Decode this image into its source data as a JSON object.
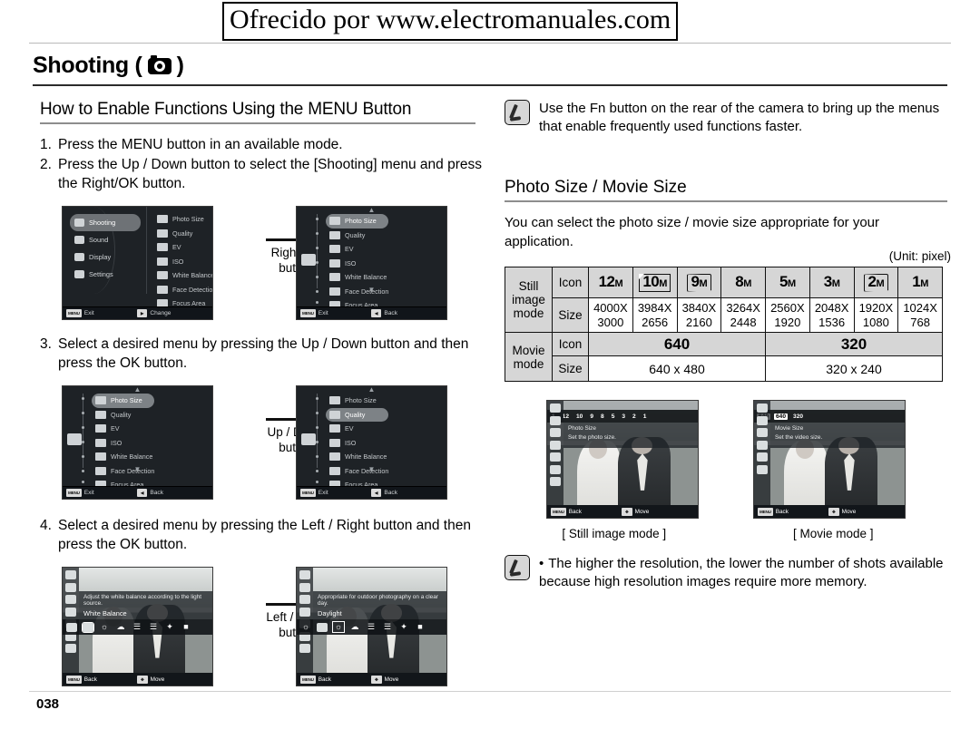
{
  "watermark": "Ofrecido por www.electromanuales.com",
  "chapter": {
    "title": "Shooting (",
    "title_close": ")",
    "icon": "camera-icon"
  },
  "left": {
    "heading": "How to Enable Functions Using the MENU Button",
    "steps": [
      {
        "num": "1.",
        "text": "Press the MENU button in an available mode."
      },
      {
        "num": "2.",
        "text": "Press the Up / Down button to select the [Shooting] menu and press the Right/OK button."
      },
      {
        "num": "3.",
        "text": "Select a desired menu by pressing the Up / Down button and then press the OK button."
      },
      {
        "num": "4.",
        "text": "Select a desired menu by pressing the Left / Right button and then press the OK button."
      }
    ],
    "arrows": [
      {
        "line1": "Right/OK",
        "line2": "button"
      },
      {
        "line1": "Up / Down",
        "line2": "button"
      },
      {
        "line1": "Left / Right",
        "line2": "button"
      }
    ]
  },
  "menu_screen_1": {
    "modes": [
      {
        "label": "Shooting",
        "icon": "camera-icon",
        "selected": true
      },
      {
        "label": "Sound",
        "icon": "speaker-icon",
        "selected": false
      },
      {
        "label": "Display",
        "icon": "display-icon",
        "selected": false
      },
      {
        "label": "Settings",
        "icon": "gear-icon",
        "selected": false
      }
    ],
    "options": [
      {
        "label": "Photo Size",
        "icon": "photo-size-icon"
      },
      {
        "label": "Quality",
        "icon": "quality-icon"
      },
      {
        "label": "EV",
        "icon": "ev-icon"
      },
      {
        "label": "ISO",
        "icon": "iso-icon"
      },
      {
        "label": "White Balance",
        "icon": "white-balance-icon"
      },
      {
        "label": "Face Detection",
        "icon": "face-detection-icon"
      },
      {
        "label": "Focus Area",
        "icon": "focus-area-icon"
      }
    ],
    "footer_left_key": "MENU",
    "footer_left_label": "Exit",
    "footer_right_key": "▶",
    "footer_right_label": "Change"
  },
  "menu_screen_2": {
    "selected": "Photo Size",
    "footer_left_key": "MENU",
    "footer_left_label": "Exit",
    "footer_right_key": "◀",
    "footer_right_label": "Back"
  },
  "menu_screen_3": {
    "selected": "Photo Size",
    "footer_left_key": "MENU",
    "footer_left_label": "Exit",
    "footer_right_key": "◀",
    "footer_right_label": "Back"
  },
  "menu_screen_4": {
    "selected": "Quality",
    "footer_left_key": "MENU",
    "footer_left_label": "Exit",
    "footer_right_key": "◀",
    "footer_right_label": "Back"
  },
  "wb_screen_1": {
    "desc": "Adjust the white balance according to the light source.",
    "name": "White Balance",
    "footer_left_key": "MENU",
    "footer_left_label": "Back",
    "footer_right_key": "✥",
    "footer_right_label": "Move"
  },
  "wb_screen_2": {
    "desc": "Appropriate for outdoor photography on a clear day.",
    "name": "Daylight",
    "footer_left_key": "MENU",
    "footer_left_label": "Back",
    "footer_right_key": "✥",
    "footer_right_label": "Move"
  },
  "right": {
    "note1": "Use the Fn button on the rear of the camera to bring up the menus that enable frequently used functions faster.",
    "heading": "Photo Size / Movie Size",
    "paragraph": "You can select the photo size / movie size appropriate for your application.",
    "unit": "(Unit: pixel)",
    "note2": "The higher the resolution, the lower the number of shots available because high resolution images require more memory.",
    "caption_still": "[ Still image mode ]",
    "caption_movie": "[ Movie mode ]"
  },
  "still_screen": {
    "sizes": [
      "1",
      "12",
      "10",
      "9",
      "8",
      "5",
      "3",
      "2",
      "1"
    ],
    "title": "Photo Size",
    "desc": "Set the photo size.",
    "footer_left_key": "MENU",
    "footer_left_label": "Back",
    "footer_right_key": "✥",
    "footer_right_label": "Move"
  },
  "movie_screen": {
    "sizes": [
      "640",
      "640",
      "320"
    ],
    "title": "Movie Size",
    "desc": "Set the video size.",
    "footer_left_key": "MENU",
    "footer_left_label": "Back",
    "footer_right_key": "✥",
    "footer_right_label": "Move"
  },
  "chart_data": {
    "type": "table",
    "title": "Photo Size / Movie Size",
    "unit": "(Unit: pixel)",
    "still": {
      "row_label": "Still image mode",
      "icon_label": "Icon",
      "size_label": "Size",
      "icons": [
        {
          "num": "12",
          "m": "M",
          "style": "plain"
        },
        {
          "num": "10",
          "m": "M",
          "style": "corner"
        },
        {
          "num": "9",
          "m": "M",
          "style": "wavy"
        },
        {
          "num": "8",
          "m": "M",
          "style": "plain"
        },
        {
          "num": "5",
          "m": "M",
          "style": "plain"
        },
        {
          "num": "3",
          "m": "M",
          "style": "plain"
        },
        {
          "num": "2",
          "m": "M",
          "style": "wavy"
        },
        {
          "num": "1",
          "m": "M",
          "style": "plain"
        }
      ],
      "sizes_w": [
        "4000X",
        "3984X",
        "3840X",
        "3264X",
        "2560X",
        "2048X",
        "1920X",
        "1024X"
      ],
      "sizes_h": [
        "3000",
        "2656",
        "2160",
        "2448",
        "1920",
        "1536",
        "1080",
        "768"
      ]
    },
    "movie": {
      "row_label": "Movie mode",
      "icon_label": "Icon",
      "size_label": "Size",
      "icons": [
        "640",
        "320"
      ],
      "sizes": [
        "640 x 480",
        "320 x 240"
      ]
    }
  },
  "page_number": "038"
}
